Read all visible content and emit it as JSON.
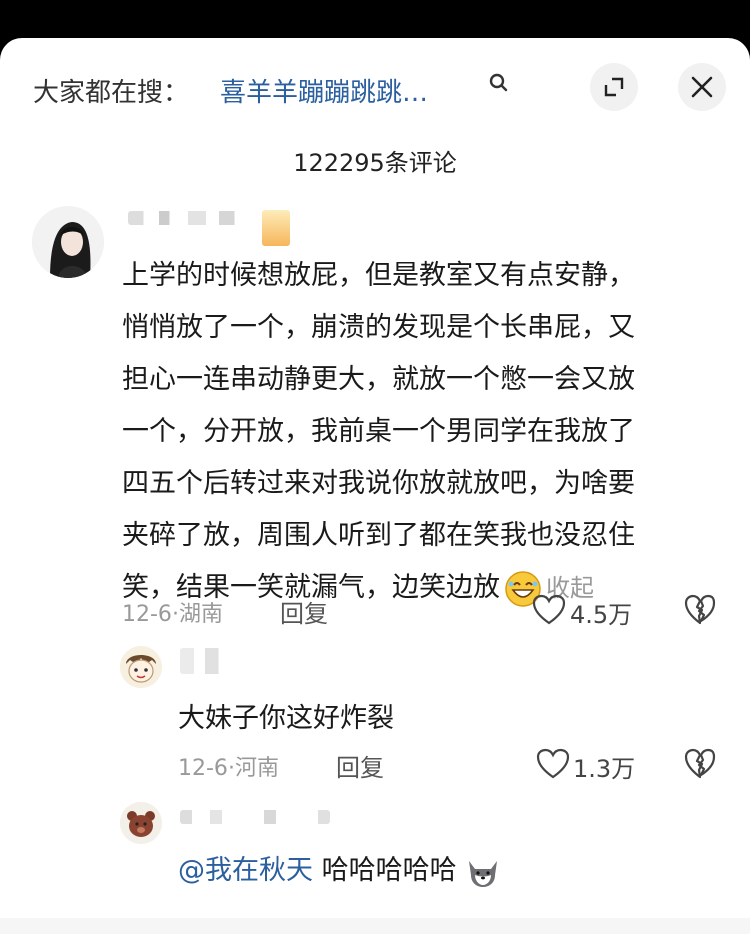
{
  "header": {
    "search_label": "大家都在搜：",
    "search_query": "喜羊羊蹦蹦跳跳…",
    "comment_count": "122295条评论"
  },
  "comments": [
    {
      "text_lines": [
        "上学的时候想放屁，但是教室又有点安静，",
        "悄悄放了一个，崩溃的发现是个长串屁，又",
        "担心一连串动静更大，就放一个憋一会又放",
        "一个，分开放，我前桌一个男同学在我放了",
        "四五个后转过来对我说你放就放吧，为啥要",
        "夹碎了放，周围人听到了都在笑我也没忍住",
        "笑，结果一笑就漏气，边笑边放"
      ],
      "collapse_label": "收起",
      "date": "12-6",
      "location": "湖南",
      "reply_label": "回复",
      "likes": "4.5万"
    }
  ],
  "replies": [
    {
      "text": "大妹子你这好炸裂",
      "date": "12-6",
      "location": "河南",
      "reply_label": "回复",
      "likes": "1.3万"
    },
    {
      "mention": "@我在秋天",
      "text": "哈哈哈哈哈"
    }
  ],
  "colors": {
    "link_blue": "#2b5f9e",
    "meta_gray": "#999999",
    "text": "#1a1a1a"
  },
  "icons": [
    "search-icon",
    "expand-icon",
    "close-icon",
    "heart-icon",
    "broken-heart-icon",
    "laughing-emoji-icon",
    "shiba-emoji-icon"
  ]
}
